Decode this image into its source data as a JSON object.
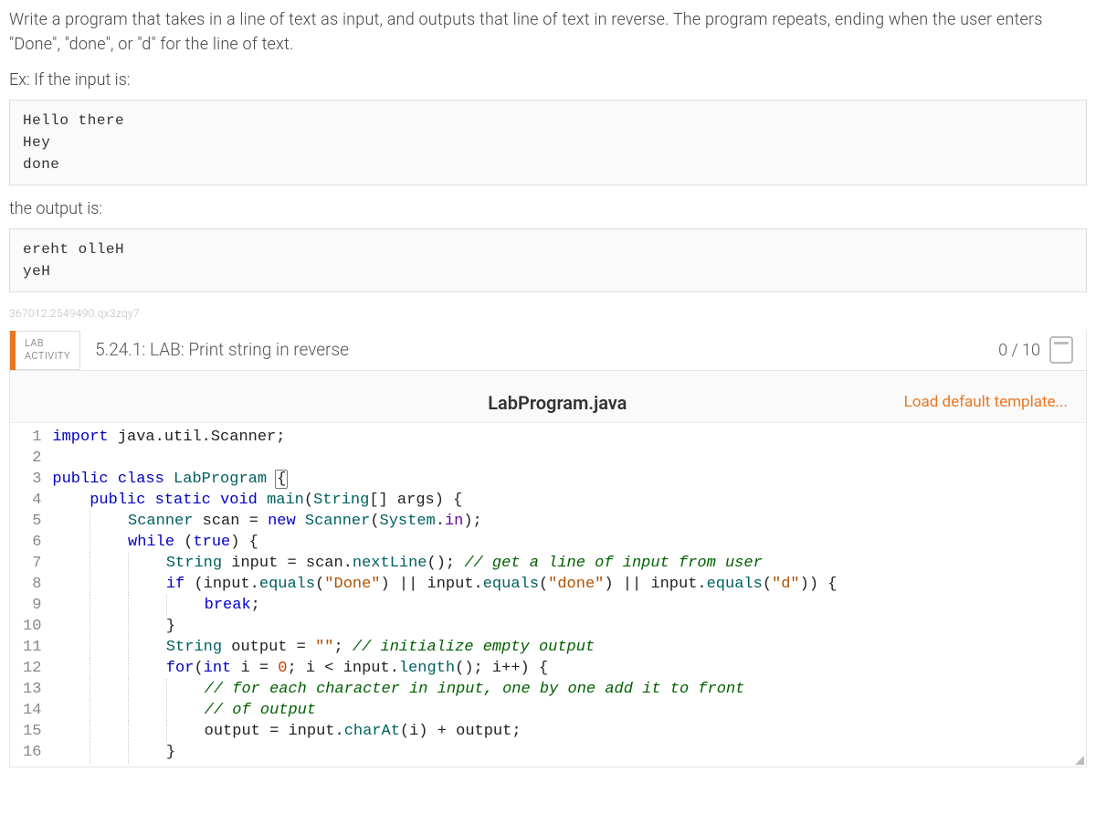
{
  "problem": {
    "description": "Write a program that takes in a line of text as input, and outputs that line of text in reverse. The program repeats, ending when the user enters \"Done\", \"done\", or \"d\" for the line of text.",
    "example_prefix": "Ex: If the input is:",
    "input_sample": "Hello there\nHey\ndone",
    "output_label": "the output is:",
    "output_sample": "ereht olleH\nyeH",
    "qxid": "367012.2549490.qx3zqy7"
  },
  "lab": {
    "activity_label_line1": "LAB",
    "activity_label_line2": "ACTIVITY",
    "title": "5.24.1: LAB: Print string in reverse",
    "score": "0 / 10"
  },
  "editor": {
    "filename": "LabProgram.java",
    "load_template_label": "Load default template...",
    "line_count": 16,
    "code_lines": [
      {
        "n": 1,
        "tokens": [
          [
            "blue",
            "import"
          ],
          [
            "plain",
            " java.util.Scanner;"
          ]
        ]
      },
      {
        "n": 2,
        "tokens": []
      },
      {
        "n": 3,
        "tokens": [
          [
            "blue",
            "public"
          ],
          [
            "plain",
            " "
          ],
          [
            "blue",
            "class"
          ],
          [
            "plain",
            " "
          ],
          [
            "teal",
            "LabProgram"
          ],
          [
            "plain",
            " "
          ],
          [
            "bracehl",
            "{"
          ]
        ]
      },
      {
        "n": 4,
        "indent": 1,
        "tokens": [
          [
            "blue",
            "public"
          ],
          [
            "plain",
            " "
          ],
          [
            "blue",
            "static"
          ],
          [
            "plain",
            " "
          ],
          [
            "blue",
            "void"
          ],
          [
            "plain",
            " "
          ],
          [
            "teal",
            "main"
          ],
          [
            "plain",
            "("
          ],
          [
            "teal",
            "String"
          ],
          [
            "plain",
            "[] args) {"
          ]
        ]
      },
      {
        "n": 5,
        "indent": 2,
        "tokens": [
          [
            "teal",
            "Scanner"
          ],
          [
            "plain",
            " scan = "
          ],
          [
            "blue",
            "new"
          ],
          [
            "plain",
            " "
          ],
          [
            "teal",
            "Scanner"
          ],
          [
            "plain",
            "("
          ],
          [
            "teal",
            "System"
          ],
          [
            "plain",
            "."
          ],
          [
            "purple",
            "in"
          ],
          [
            "plain",
            ");"
          ]
        ]
      },
      {
        "n": 6,
        "indent": 2,
        "tokens": [
          [
            "blue",
            "while"
          ],
          [
            "plain",
            " ("
          ],
          [
            "blue",
            "true"
          ],
          [
            "plain",
            ") {"
          ]
        ]
      },
      {
        "n": 7,
        "indent": 3,
        "tokens": [
          [
            "teal",
            "String"
          ],
          [
            "plain",
            " input = scan."
          ],
          [
            "teal",
            "nextLine"
          ],
          [
            "plain",
            "(); "
          ],
          [
            "green",
            "// get a line of input from user"
          ]
        ]
      },
      {
        "n": 8,
        "indent": 3,
        "tokens": [
          [
            "blue",
            "if"
          ],
          [
            "plain",
            " (input."
          ],
          [
            "teal",
            "equals"
          ],
          [
            "plain",
            "("
          ],
          [
            "str",
            "\"Done\""
          ],
          [
            "plain",
            ") || input."
          ],
          [
            "teal",
            "equals"
          ],
          [
            "plain",
            "("
          ],
          [
            "str",
            "\"done\""
          ],
          [
            "plain",
            ") || input."
          ],
          [
            "teal",
            "equals"
          ],
          [
            "plain",
            "("
          ],
          [
            "str",
            "\"d\""
          ],
          [
            "plain",
            ")) {"
          ]
        ]
      },
      {
        "n": 9,
        "indent": 4,
        "altguide": true,
        "tokens": [
          [
            "blue",
            "break"
          ],
          [
            "plain",
            ";"
          ]
        ]
      },
      {
        "n": 10,
        "indent": 3,
        "tokens": [
          [
            "plain",
            "}"
          ]
        ]
      },
      {
        "n": 11,
        "indent": 3,
        "tokens": [
          [
            "teal",
            "String"
          ],
          [
            "plain",
            " output = "
          ],
          [
            "str",
            "\"\""
          ],
          [
            "plain",
            "; "
          ],
          [
            "green",
            "// initialize empty output"
          ]
        ]
      },
      {
        "n": 12,
        "indent": 3,
        "tokens": [
          [
            "blue",
            "for"
          ],
          [
            "plain",
            "("
          ],
          [
            "blue",
            "int"
          ],
          [
            "plain",
            " i = "
          ],
          [
            "orange",
            "0"
          ],
          [
            "plain",
            "; i < input."
          ],
          [
            "teal",
            "length"
          ],
          [
            "plain",
            "(); i++) {"
          ]
        ]
      },
      {
        "n": 13,
        "indent": 4,
        "tokens": [
          [
            "green",
            "// for each character in input, one by one add it to front"
          ]
        ]
      },
      {
        "n": 14,
        "indent": 4,
        "tokens": [
          [
            "green",
            "// of output"
          ]
        ]
      },
      {
        "n": 15,
        "indent": 4,
        "tokens": [
          [
            "plain",
            "output = input."
          ],
          [
            "teal",
            "charAt"
          ],
          [
            "plain",
            "(i) + output;"
          ]
        ]
      },
      {
        "n": 16,
        "indent": 3,
        "tokens": [
          [
            "plain",
            "}"
          ]
        ]
      }
    ]
  }
}
